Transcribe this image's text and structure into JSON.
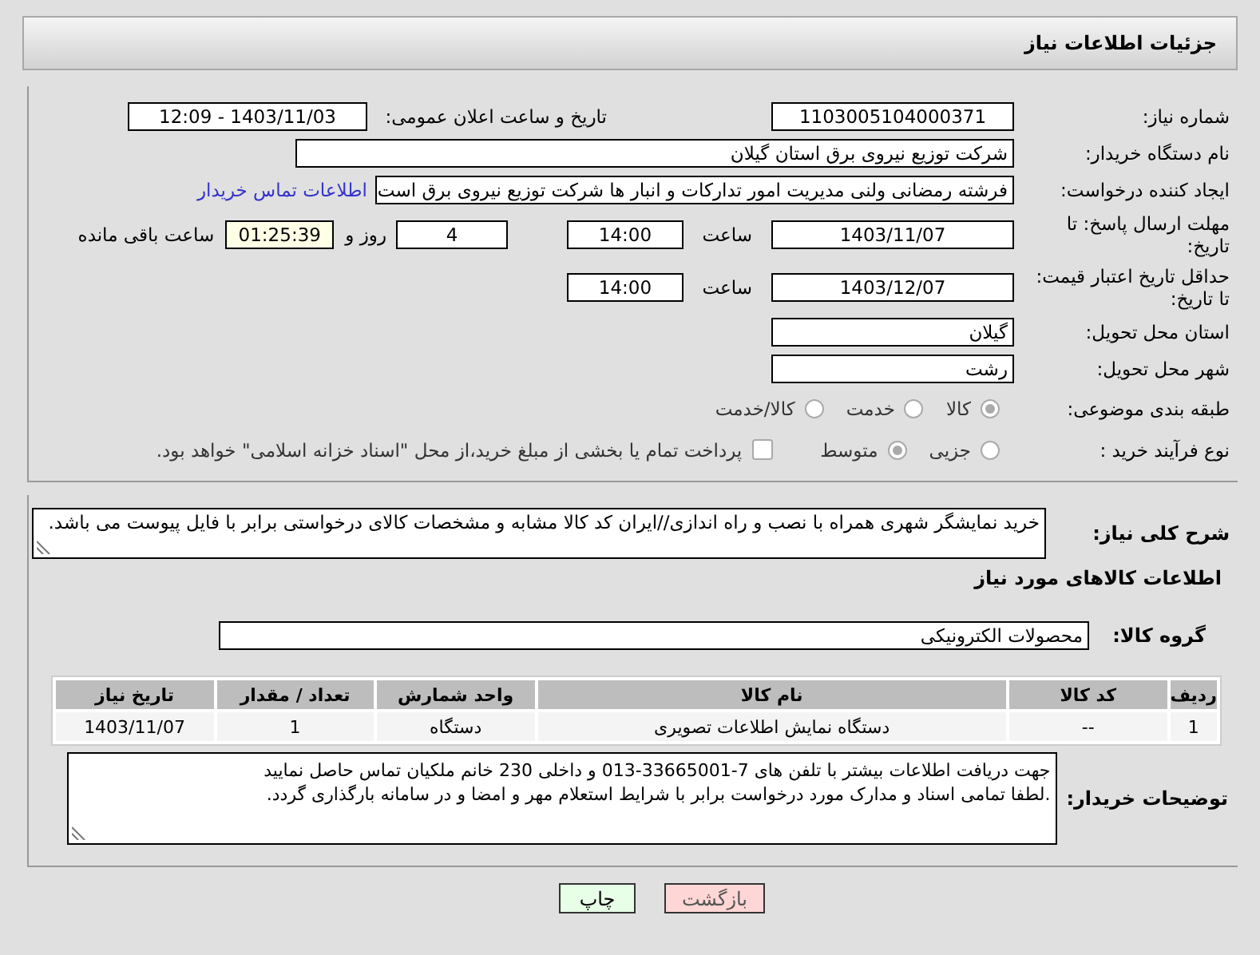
{
  "header": {
    "title": "جزئیات اطلاعات نیاز"
  },
  "need_number": {
    "label": "شماره نیاز:",
    "value": "1103005104000371"
  },
  "announce": {
    "label": "تاریخ و ساعت اعلان عمومی:",
    "value": "1403/11/03 - 12:09"
  },
  "buyer_org": {
    "label": "نام دستگاه خریدار:",
    "value": "شرکت توزیع نیروی برق استان گیلان"
  },
  "creator": {
    "label": "ایجاد کننده درخواست:",
    "value": "فرشته رمضانی ولنی مدیریت امور تدارکات و انبار ها شرکت توزیع نیروی برق است",
    "link": "اطلاعات تماس خریدار"
  },
  "reply_deadline": {
    "label": "مهلت ارسال پاسخ: تا تاریخ:",
    "date": "1403/11/07",
    "time_label": "ساعت",
    "time": "14:00",
    "days": "4",
    "days_label": "روز و",
    "remaining": "01:25:39",
    "remaining_label": "ساعت باقی مانده"
  },
  "price_validity": {
    "label": "حداقل تاریخ اعتبار قیمت: تا تاریخ:",
    "date": "1403/12/07",
    "time_label": "ساعت",
    "time": "14:00"
  },
  "province": {
    "label": "استان محل تحویل:",
    "value": "گیلان"
  },
  "city": {
    "label": "شهر محل تحویل:",
    "value": "رشت"
  },
  "category": {
    "label": "طبقه بندی موضوعی:",
    "options": [
      {
        "label": "کالا",
        "selected": true
      },
      {
        "label": "خدمت",
        "selected": false
      },
      {
        "label": "کالا/خدمت",
        "selected": false
      }
    ]
  },
  "process": {
    "label": "نوع فرآیند خرید :",
    "options": [
      {
        "label": "جزیی",
        "selected": false
      },
      {
        "label": "متوسط",
        "selected": true
      }
    ],
    "payment": {
      "label": "پرداخت تمام یا بخشی از مبلغ خرید،از محل \"اسناد خزانه اسلامی\" خواهد بود.",
      "checked": false
    }
  },
  "description": {
    "label": "شرح کلی نیاز:",
    "value": "خرید نمایشگر شهری همراه با نصب و راه اندازی//ایران کد کالا مشابه و مشخصات کالای درخواستی برابر با فایل پیوست می باشد."
  },
  "goods_heading": "اطلاعات کالاهای مورد نیاز",
  "goods_group": {
    "label": "گروه کالا:",
    "value": "محصولات الکترونیکی"
  },
  "table": {
    "columns": [
      "ردیف",
      "کد کالا",
      "نام کالا",
      "واحد شمارش",
      "تعداد / مقدار",
      "تاریخ نیاز"
    ],
    "rows": [
      [
        "1",
        "--",
        "دستگاه نمایش اطلاعات تصویری",
        "دستگاه",
        "1",
        "1403/11/07"
      ]
    ]
  },
  "buyer_notes": {
    "label": "توضیحات خریدار:",
    "lines": [
      "جهت دریافت اطلاعات بیشتر با تلفن های 7-33665001-013 و داخلی 230 خانم ملکیان تماس حاصل نمایید",
      ".لطفا تمامی اسناد و مدارک مورد درخواست برابر با شرایط استعلام مهر و امضا و در سامانه بارگذاری گردد."
    ]
  },
  "buttons": [
    {
      "kind": "back",
      "label": "بازگشت"
    },
    {
      "kind": "print",
      "label": "چاپ"
    }
  ]
}
